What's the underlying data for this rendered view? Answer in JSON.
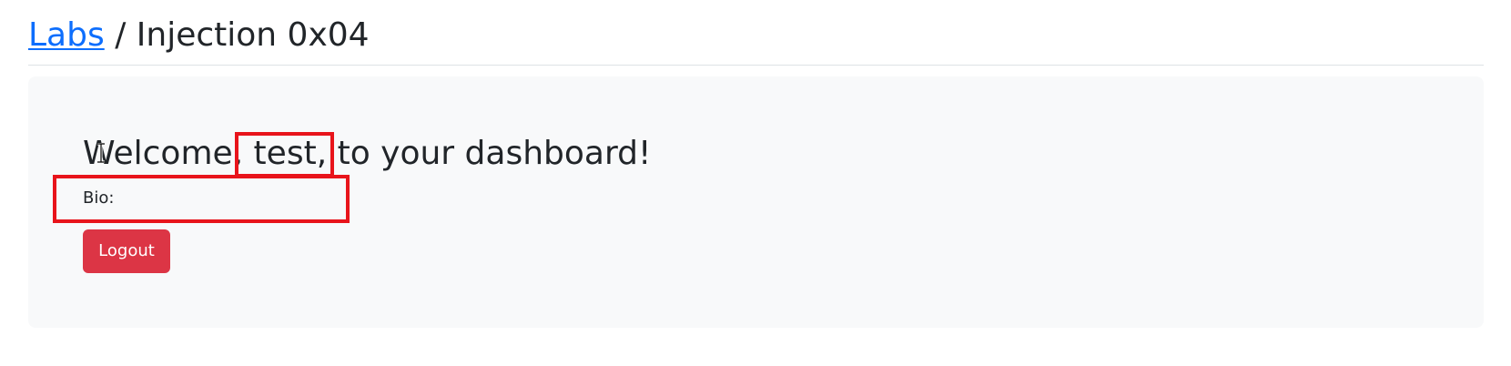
{
  "breadcrumb": {
    "link_label": "Labs",
    "separator": "/",
    "current": "Injection 0x04"
  },
  "dashboard": {
    "welcome_text": "Welcome, test, to your dashboard!",
    "bio_label": "Bio:",
    "bio_value": "",
    "logout_label": "Logout"
  },
  "colors": {
    "link": "#0d6efd",
    "card_background": "#f8f9fa",
    "logout_button": "#dc3545",
    "highlight_box": "#e8141b"
  },
  "icons": {
    "cursor": "text-cursor-icon"
  }
}
